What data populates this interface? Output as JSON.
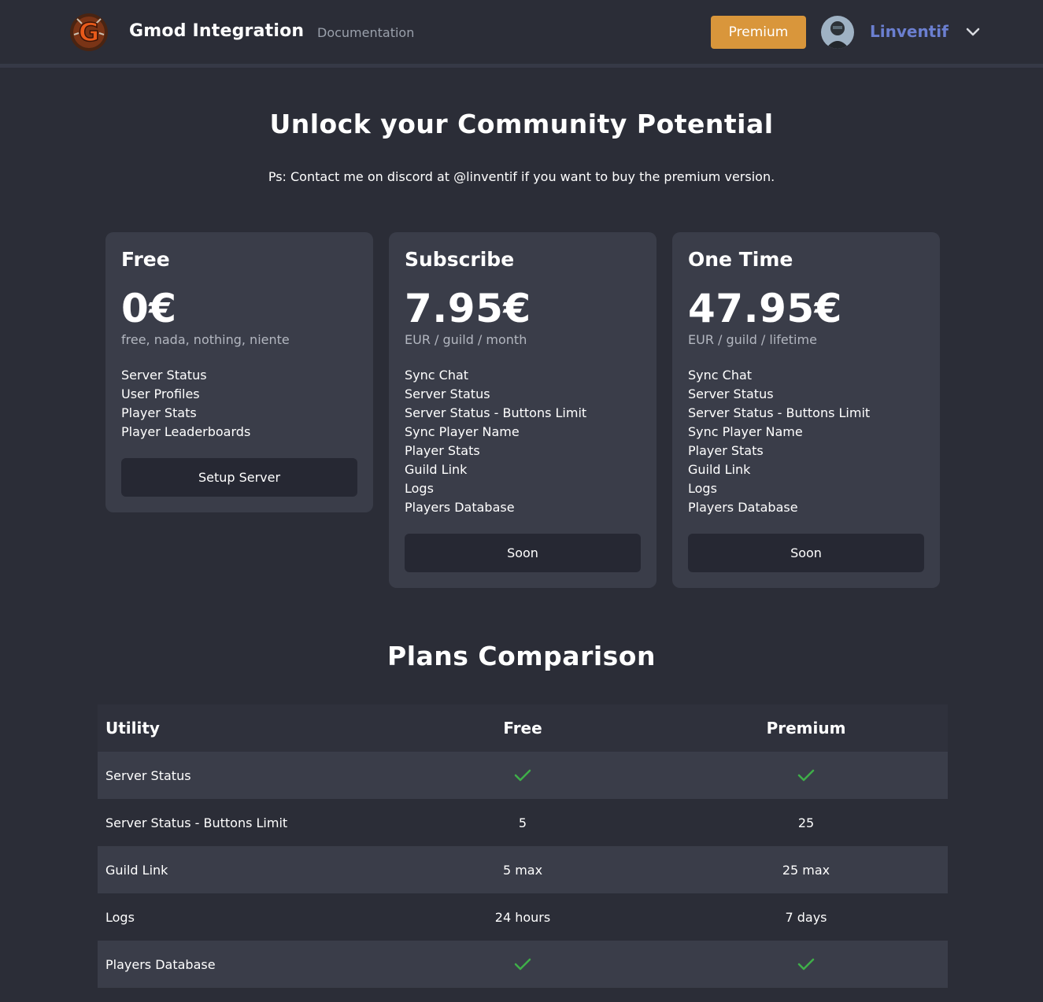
{
  "nav": {
    "brand": "Gmod Integration",
    "documentation": "Documentation",
    "premium": "Premium",
    "username": "Linventif"
  },
  "hero": {
    "title": "Unlock your Community Potential",
    "subtitle": "Ps: Contact me on discord at @linventif if you want to buy the premium version."
  },
  "plans": [
    {
      "title": "Free",
      "price": "0€",
      "period": "free, nada, nothing, niente",
      "features": [
        "Server Status",
        "User Profiles",
        "Player Stats",
        "Player Leaderboards"
      ],
      "button": "Setup Server"
    },
    {
      "title": "Subscribe",
      "price": "7.95€",
      "period": "EUR / guild / month",
      "features": [
        "Sync Chat",
        "Server Status",
        "Server Status - Buttons Limit",
        "Sync Player Name",
        "Player Stats",
        "Guild Link",
        "Logs",
        "Players Database"
      ],
      "button": "Soon"
    },
    {
      "title": "One Time",
      "price": "47.95€",
      "period": "EUR / guild / lifetime",
      "features": [
        "Sync Chat",
        "Server Status",
        "Server Status - Buttons Limit",
        "Sync Player Name",
        "Player Stats",
        "Guild Link",
        "Logs",
        "Players Database"
      ],
      "button": "Soon"
    }
  ],
  "comparison": {
    "title": "Plans Comparison",
    "headers": [
      "Utility",
      "Free",
      "Premium"
    ],
    "rows": [
      [
        "Server Status",
        "check-icon",
        "check-icon"
      ],
      [
        "Server Status - Buttons Limit",
        "5",
        "25"
      ],
      [
        "Guild Link",
        "5 max",
        "25 max"
      ],
      [
        "Logs",
        "24 hours",
        "7 days"
      ],
      [
        "Players Database",
        "check-icon",
        "check-icon"
      ]
    ]
  },
  "colors": {
    "background": "#2b2d37",
    "card": "#3a3d49",
    "premium_button": "#d9963b",
    "username": "#6b7fd0",
    "check": "#3fae49"
  }
}
